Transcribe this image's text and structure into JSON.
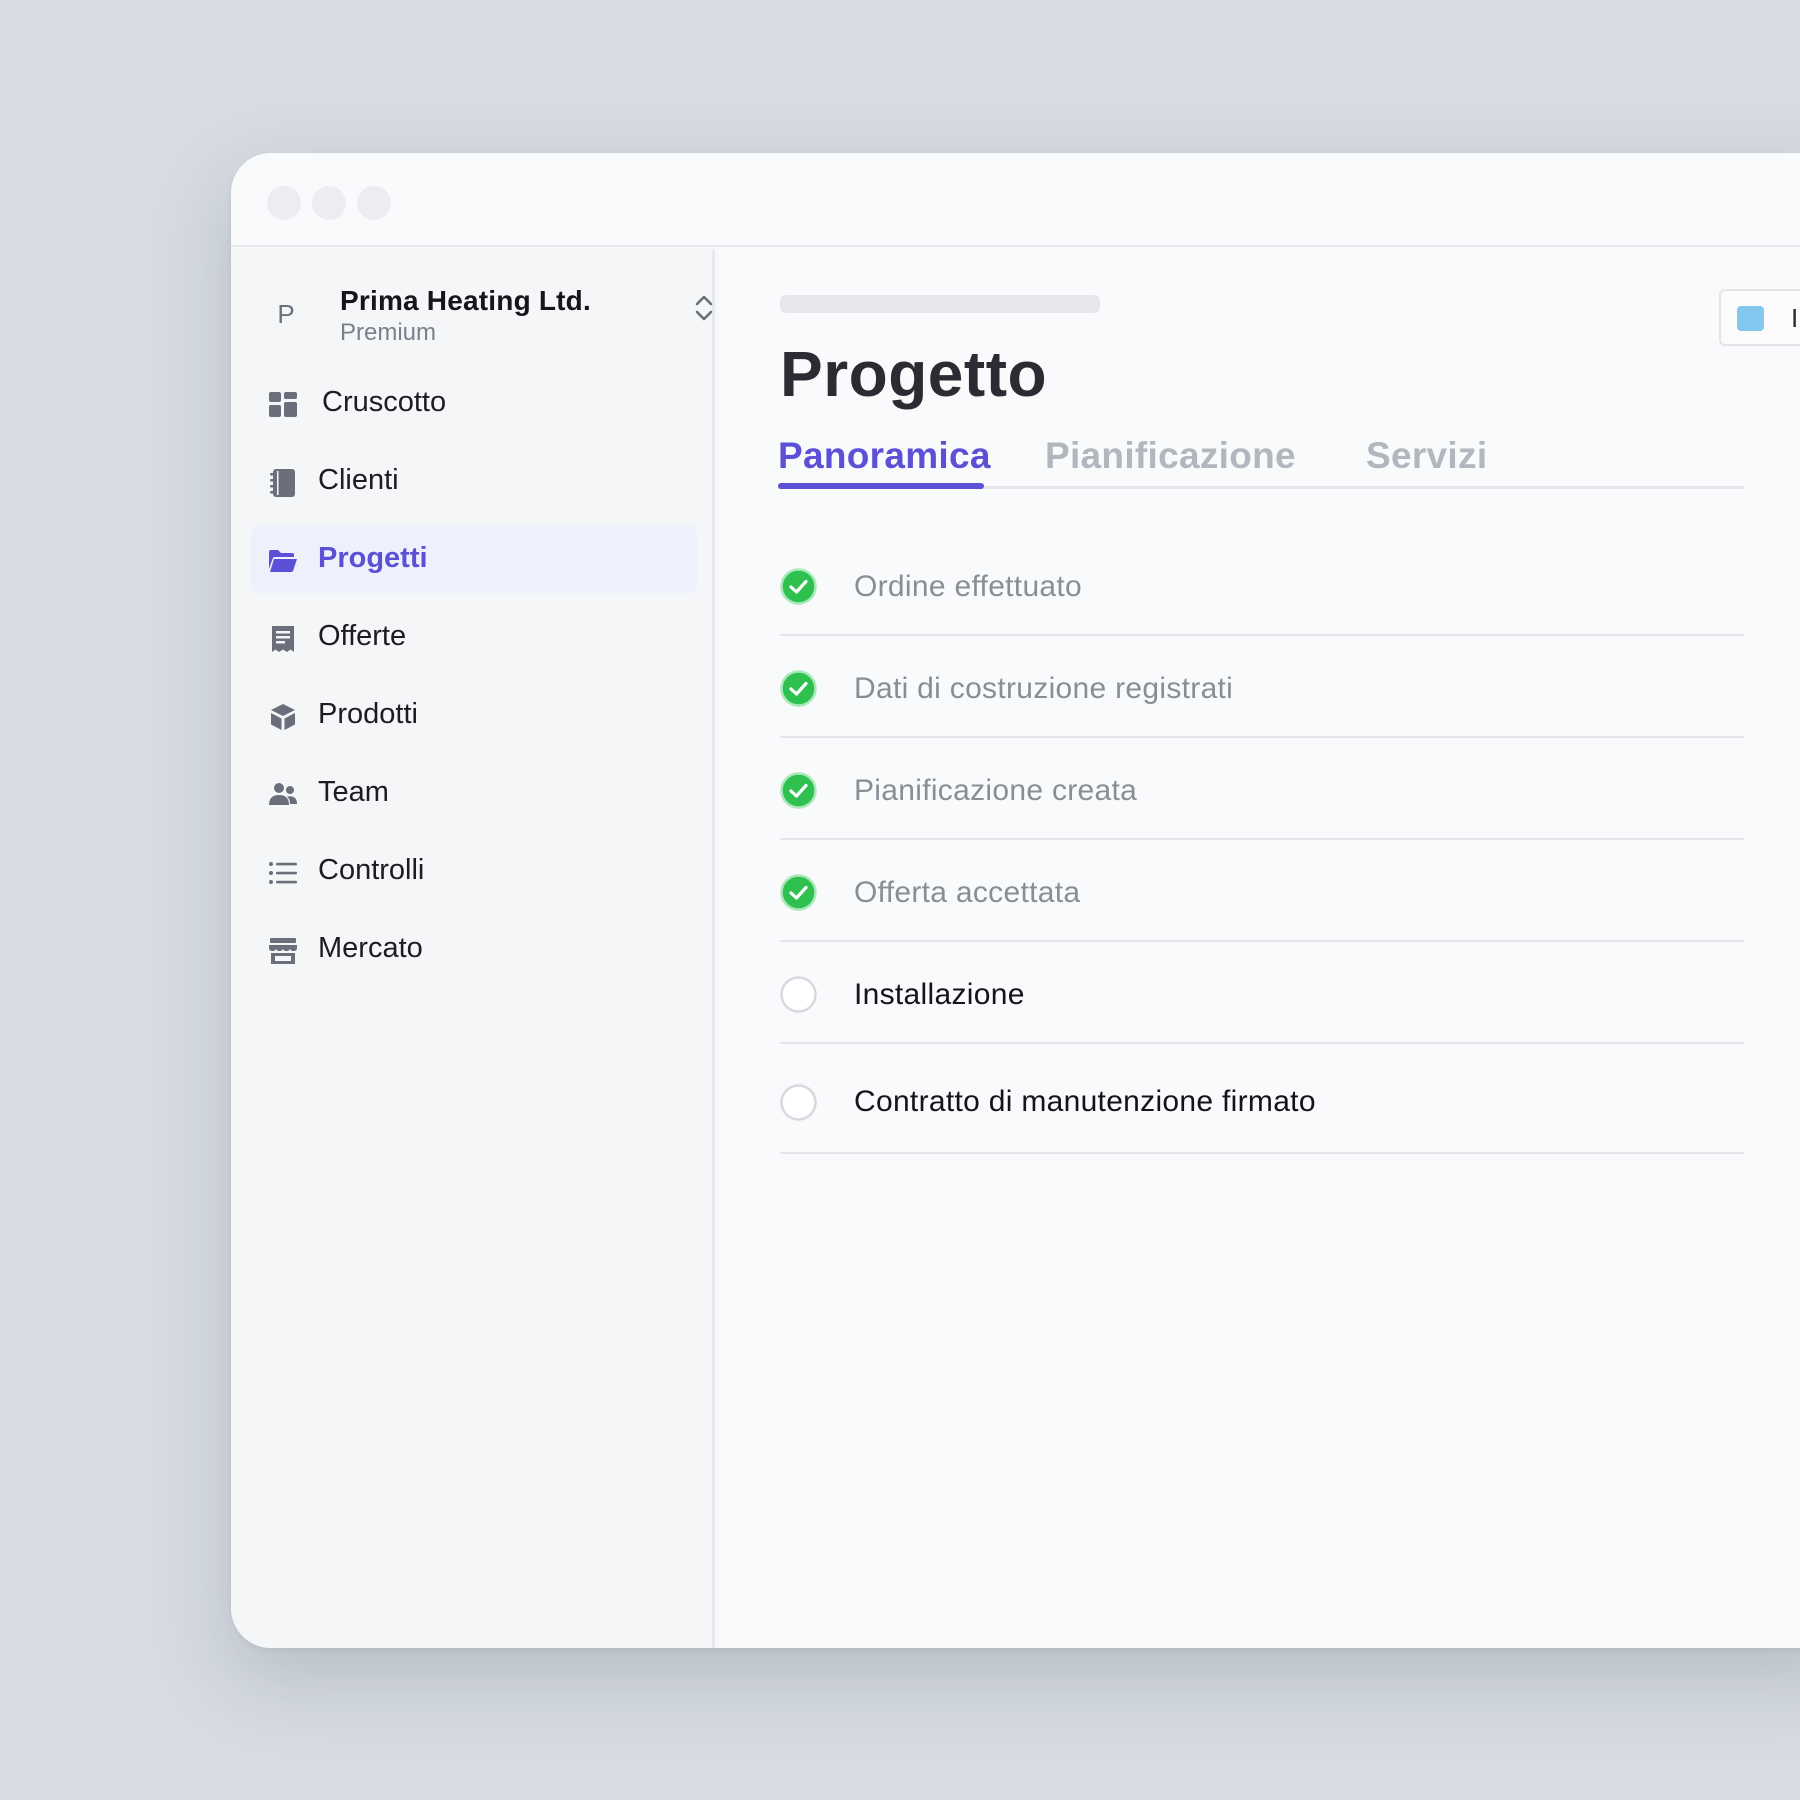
{
  "org": {
    "avatar_letter": "P",
    "name": "Prima Heating Ltd.",
    "plan": "Premium"
  },
  "sidebar": {
    "items": [
      {
        "label": "Cruscotto",
        "icon": "dashboard-icon",
        "active": false
      },
      {
        "label": "Clienti",
        "icon": "address-book-icon",
        "active": false
      },
      {
        "label": "Progetti",
        "icon": "folder-open-icon",
        "active": true
      },
      {
        "label": "Offerte",
        "icon": "receipt-icon",
        "active": false
      },
      {
        "label": "Prodotti",
        "icon": "cube-icon",
        "active": false
      },
      {
        "label": "Team",
        "icon": "users-icon",
        "active": false
      },
      {
        "label": "Controlli",
        "icon": "list-icon",
        "active": false
      },
      {
        "label": "Mercato",
        "icon": "store-icon",
        "active": false
      }
    ]
  },
  "main": {
    "title": "Progetto",
    "status": {
      "label": "In corso",
      "color": "#82c7ee"
    },
    "tabs": [
      {
        "label": "Panoramica",
        "active": true
      },
      {
        "label": "Pianificazione",
        "active": false
      },
      {
        "label": "Servizi",
        "active": false
      }
    ],
    "steps": [
      {
        "label": "Ordine effettuato",
        "done": true
      },
      {
        "label": "Dati di costruzione registrati",
        "done": true
      },
      {
        "label": "Pianificazione creata",
        "done": true
      },
      {
        "label": "Offerta accettata",
        "done": true
      },
      {
        "label": "Installazione",
        "done": false
      },
      {
        "label": "Contratto di manutenzione firmato",
        "done": false
      }
    ]
  },
  "colors": {
    "accent": "#5b50d6",
    "done": "#2fc14f",
    "background": "#d7dce2"
  }
}
